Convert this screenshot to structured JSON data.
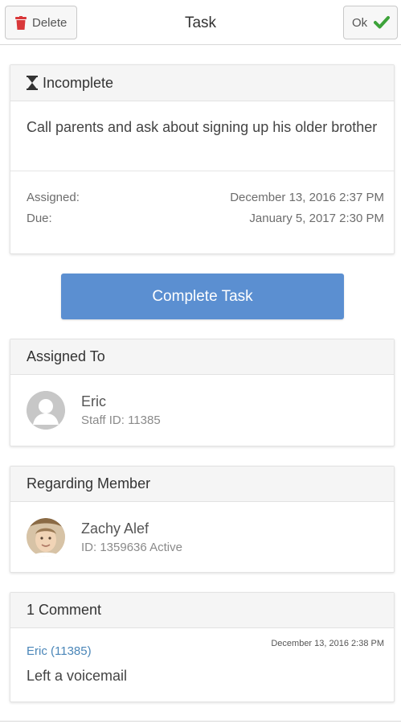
{
  "toolbar": {
    "delete_label": "Delete",
    "title": "Task",
    "ok_label": "Ok"
  },
  "task": {
    "status": "Incomplete",
    "description": "Call parents and ask about signing up his older brother",
    "assigned_label": "Assigned:",
    "assigned_value": "December 13, 2016 2:37 PM",
    "due_label": "Due:",
    "due_value": "January 5, 2017 2:30 PM"
  },
  "complete_button": "Complete Task",
  "assigned_to": {
    "header": "Assigned To",
    "name": "Eric",
    "sub": "Staff ID: 11385"
  },
  "regarding": {
    "header": "Regarding Member",
    "name": "Zachy Alef",
    "sub": "ID: 1359636 Active"
  },
  "comments": {
    "header": "1 Comment",
    "items": [
      {
        "author": "Eric (11385)",
        "timestamp": "December 13, 2016 2:38 PM",
        "text": "Left a voicemail"
      }
    ]
  },
  "colors": {
    "accent_button": "#5b8fd1",
    "delete_icon": "#d9383a",
    "ok_check": "#3da33a",
    "comment_author": "#4a86b8"
  }
}
